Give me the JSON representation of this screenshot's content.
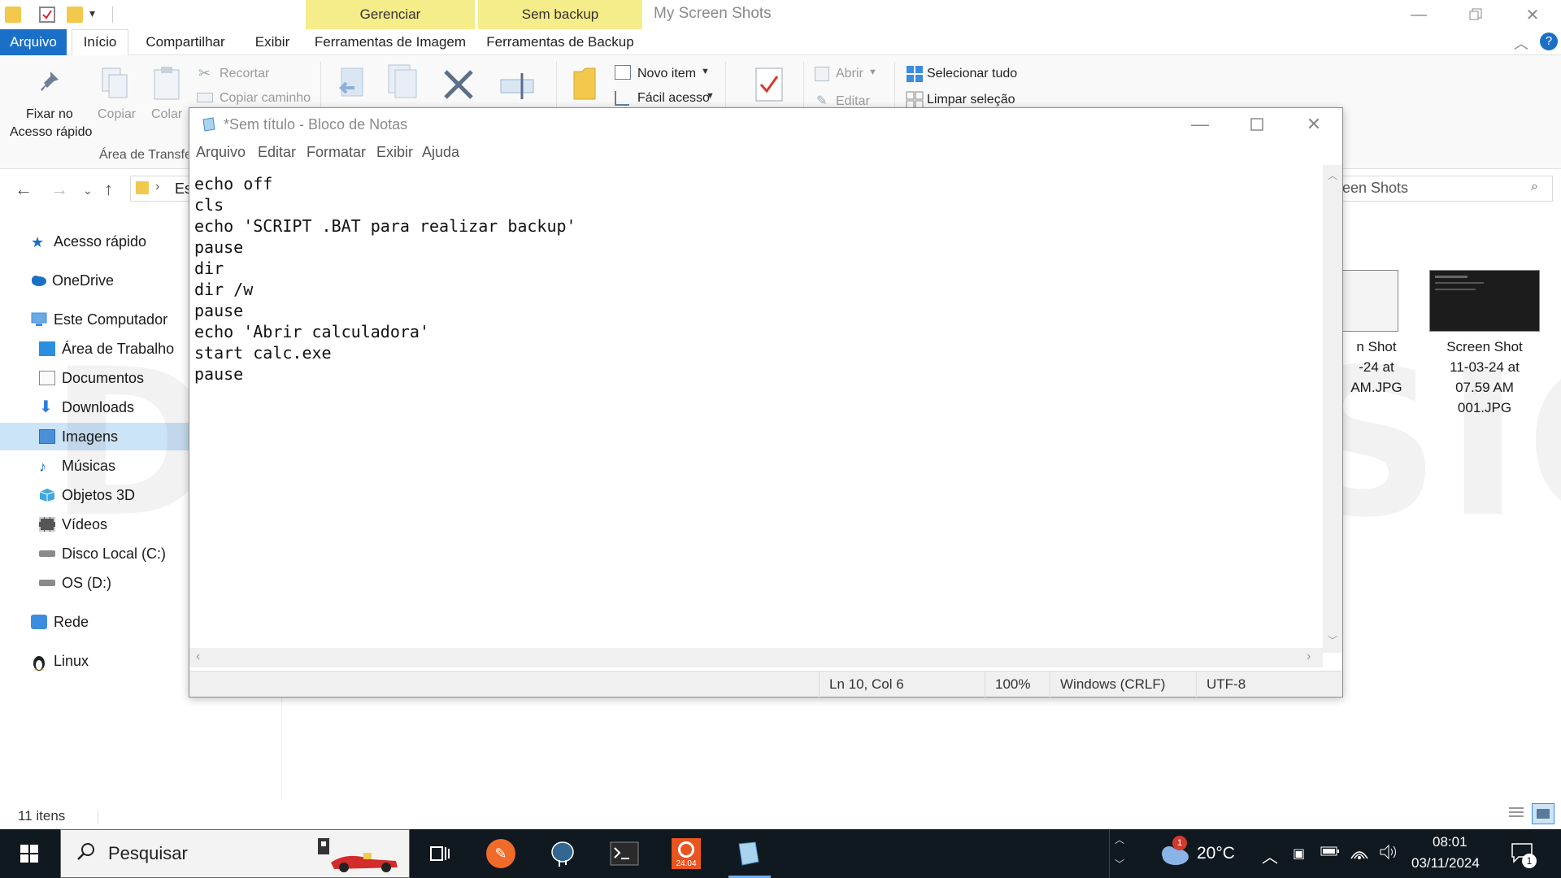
{
  "explorer": {
    "window_title": "My Screen Shots",
    "context_tabs": [
      {
        "label": "Gerenciar"
      },
      {
        "label": "Sem backup"
      }
    ],
    "ribbon_tabs": [
      {
        "label": "Arquivo"
      },
      {
        "label": "Início"
      },
      {
        "label": "Compartilhar"
      },
      {
        "label": "Exibir"
      },
      {
        "label": "Ferramentas de Imagem"
      },
      {
        "label": "Ferramentas de Backup"
      }
    ],
    "ribbon": {
      "pin_label_1": "Fixar no",
      "pin_label_2": "Acesso rápido",
      "copy": "Copiar",
      "paste": "Colar",
      "cut": "Recortar",
      "copy_path": "Copiar caminho",
      "clipboard_group": "Área de Transfer",
      "new_item": "Novo item",
      "easy_access": "Fácil acesso",
      "open": "Abrir",
      "edit": "Editar",
      "select_all": "Selecionar tudo",
      "clear_selection": "Limpar seleção"
    },
    "address_partial": "Es",
    "search_partial": "een Shots",
    "sidebar": [
      {
        "label": "Acesso rápido",
        "icon": "star-icon",
        "color": "#1a6fc6"
      },
      {
        "label": "OneDrive",
        "icon": "cloud-icon",
        "color": "#1a6fc6"
      },
      {
        "label": "Este Computador",
        "icon": "computer-icon",
        "color": "#3c8de0"
      },
      {
        "label": "Área de Trabalho",
        "icon": "desktop-icon",
        "color": "#2b8fe0"
      },
      {
        "label": "Documentos",
        "icon": "document-icon",
        "color": "#8a8a8a"
      },
      {
        "label": "Downloads",
        "icon": "download-icon",
        "color": "#2b7fd6"
      },
      {
        "label": "Imagens",
        "icon": "images-icon",
        "color": "#4a90d9"
      },
      {
        "label": "Músicas",
        "icon": "music-icon",
        "color": "#1a6fc6"
      },
      {
        "label": "Objetos 3D",
        "icon": "cube-icon",
        "color": "#3fa8e0"
      },
      {
        "label": "Vídeos",
        "icon": "film-icon",
        "color": "#555555"
      },
      {
        "label": "Disco Local (C:)",
        "icon": "drive-icon",
        "color": "#777777"
      },
      {
        "label": "OS (D:)",
        "icon": "drive-icon",
        "color": "#777777"
      },
      {
        "label": "Rede",
        "icon": "network-icon",
        "color": "#3c8de0"
      },
      {
        "label": "Linux",
        "icon": "penguin-icon",
        "color": "#333333"
      }
    ],
    "files": [
      {
        "lines": [
          "n Shot",
          "-24 at",
          "AM.JPG"
        ]
      },
      {
        "lines": [
          "Screen Shot",
          "11-03-24 at",
          "07.59 AM",
          "001.JPG"
        ]
      }
    ],
    "item_count": "11 itens",
    "watermark": "DEMO VERSION"
  },
  "notepad": {
    "title": "*Sem título - Bloco de Notas",
    "menu": [
      "Arquivo",
      "Editar",
      "Formatar",
      "Exibir",
      "Ajuda"
    ],
    "content": "echo off\ncls\necho 'SCRIPT .BAT para realizar backup'\npause\ndir\ndir /w\npause\necho 'Abrir calculadora'\nstart calc.exe\npause",
    "status": {
      "position": "Ln 10, Col 6",
      "zoom": "100%",
      "line_ending": "Windows (CRLF)",
      "encoding": "UTF-8"
    }
  },
  "taskbar": {
    "search_placeholder": "Pesquisar",
    "ubuntu_badge": "24.04",
    "weather_temp": "20°C",
    "weather_badge": "1",
    "time": "08:01",
    "date": "03/11/2024",
    "notification_count": "1"
  },
  "colors": {
    "accent": "#1a6fc6",
    "context_tab": "#f5ec8a",
    "taskbar": "#101820",
    "selected": "#cce4f7"
  }
}
